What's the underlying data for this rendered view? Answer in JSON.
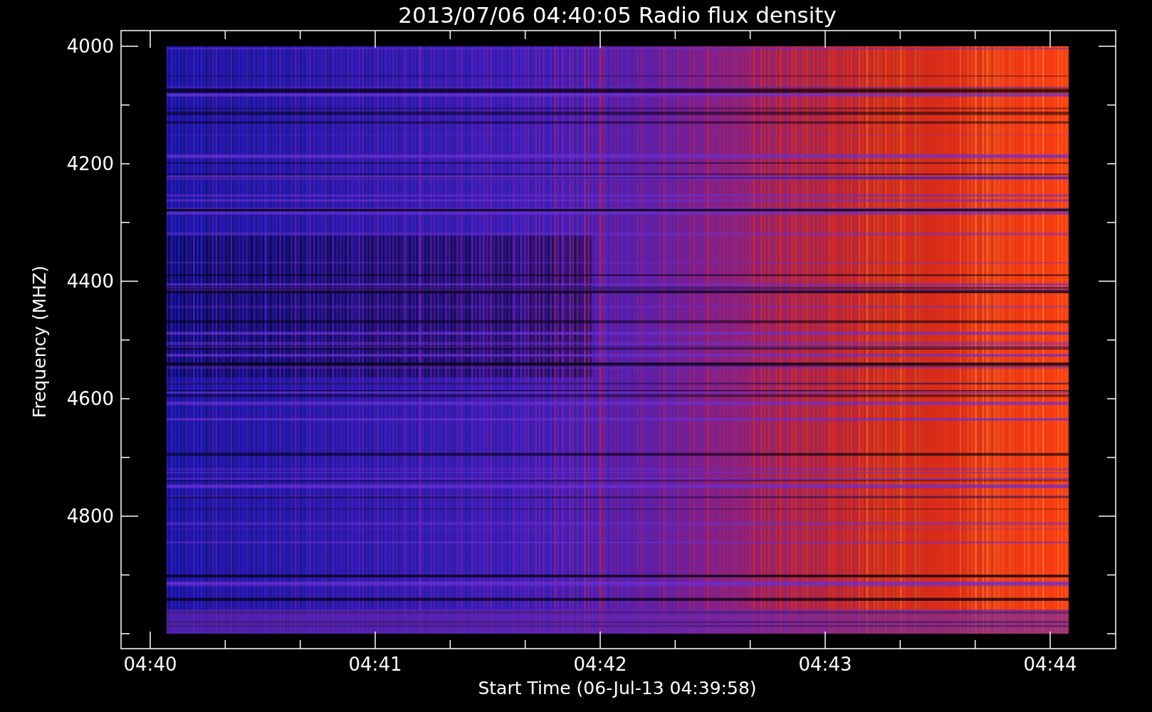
{
  "title": "2013/07/06 04:40:05 Radio flux density",
  "y_axis": {
    "label": "Frequency (MHZ)",
    "ticks": [
      "4000",
      "4200",
      "4400",
      "4600",
      "4800"
    ]
  },
  "x_axis": {
    "label": "Start Time (06-Jul-13 04:39:58)",
    "ticks": [
      "04:40",
      "04:41",
      "04:42",
      "04:43",
      "04:44"
    ]
  }
}
